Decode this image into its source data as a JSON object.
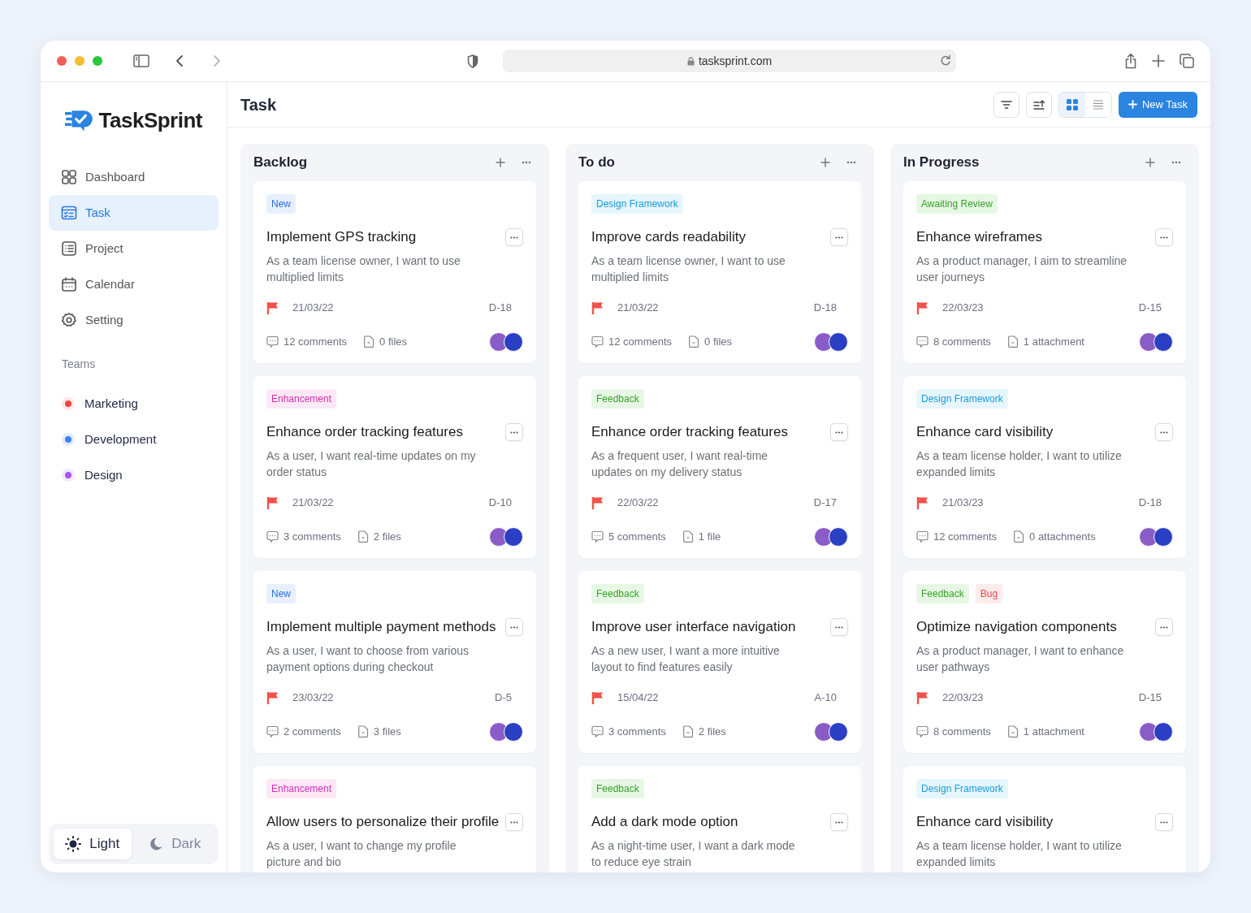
{
  "browser": {
    "url": "tasksprint.com"
  },
  "sidebar": {
    "logo": "TaskSprint",
    "items": [
      {
        "label": "Dashboard",
        "kind": "grid",
        "selected": false
      },
      {
        "label": "Task",
        "kind": "task",
        "selected": true
      },
      {
        "label": "Project",
        "kind": "list",
        "selected": false
      },
      {
        "label": "Calendar",
        "kind": "calendar",
        "selected": false
      },
      {
        "label": "Setting",
        "kind": "gear",
        "selected": false
      }
    ],
    "teams_heading": "Teams",
    "teams": [
      {
        "label": "Marketing",
        "color": "#ef4444"
      },
      {
        "label": "Development",
        "color": "#3b82f6"
      },
      {
        "label": "Design",
        "color": "#a855f7"
      }
    ],
    "theme": [
      {
        "label": "Light",
        "kind": "sun",
        "selected": true
      },
      {
        "label": "Dark",
        "kind": "moon",
        "selected": false
      }
    ]
  },
  "header": {
    "title": "Task",
    "view": [
      {
        "kind": "grid",
        "selected": true
      },
      {
        "kind": "list",
        "selected": false
      }
    ],
    "new_button": "New Task"
  },
  "columns": [
    {
      "title": "Backlog",
      "cards": [
        {
          "tags": [
            {
              "label": "New",
              "kind": "blue"
            }
          ],
          "title": "Implement GPS tracking",
          "desc": "As a team license owner, I want to use multiplied limits",
          "date": "21/03/22",
          "code": "D-18",
          "comments": "12 comments",
          "files": "0 files"
        },
        {
          "tags": [
            {
              "label": "Enhancement",
              "kind": "pink"
            }
          ],
          "title": "Enhance order tracking features",
          "desc": "As a user, I want real-time updates on my order status",
          "date": "21/03/22",
          "code": "D-10",
          "comments": "3 comments",
          "files": "2 files"
        },
        {
          "tags": [
            {
              "label": "New",
              "kind": "blue"
            }
          ],
          "title": "Implement multiple payment methods",
          "desc": "As a user, I want to choose from various payment options during checkout",
          "date": "23/03/22",
          "code": "D-5",
          "comments": "2 comments",
          "files": "3 files"
        },
        {
          "tags": [
            {
              "label": "Enhancement",
              "kind": "pink"
            }
          ],
          "title": "Allow users to personalize their profile",
          "desc": "As a user, I want to change my profile picture and bio"
        }
      ]
    },
    {
      "title": "To do",
      "cards": [
        {
          "tags": [
            {
              "label": "Design Framework",
              "kind": "cyan"
            }
          ],
          "title": "Improve cards readability",
          "desc": "As a team license owner, I want to use multiplied limits",
          "date": "21/03/22",
          "code": "D-18",
          "comments": "12 comments",
          "files": "0 files"
        },
        {
          "tags": [
            {
              "label": "Feedback",
              "kind": "green"
            }
          ],
          "title": "Enhance order tracking features",
          "desc": "As a frequent user, I want real-time updates on my delivery status",
          "date": "22/03/22",
          "code": "D-17",
          "comments": "5 comments",
          "files": "1 file"
        },
        {
          "tags": [
            {
              "label": "Feedback",
              "kind": "green"
            }
          ],
          "title": "Improve user interface navigation",
          "desc": "As a new user, I want a more intuitive layout to find features easily",
          "date": "15/04/22",
          "code": "A-10",
          "comments": "3 comments",
          "files": "2 files"
        },
        {
          "tags": [
            {
              "label": "Feedback",
              "kind": "green"
            }
          ],
          "title": "Add a dark mode option",
          "desc": "As a night-time user, I want a dark mode to reduce eye strain"
        }
      ]
    },
    {
      "title": "In Progress",
      "cards": [
        {
          "tags": [
            {
              "label": "Awaiting Review",
              "kind": "green"
            }
          ],
          "title": "Enhance wireframes",
          "desc": "As a product manager, I aim to streamline user journeys",
          "date": "22/03/23",
          "code": "D-15",
          "comments": "8 comments",
          "files": "1 attachment"
        },
        {
          "tags": [
            {
              "label": "Design Framework",
              "kind": "cyan"
            }
          ],
          "title": "Enhance card visibility",
          "desc": "As a team license holder, I want to utilize expanded limits",
          "date": "21/03/23",
          "code": "D-18",
          "comments": "12 comments",
          "files": "0 attachments"
        },
        {
          "tags": [
            {
              "label": "Feedback",
              "kind": "green"
            },
            {
              "label": "Bug",
              "kind": "red"
            }
          ],
          "title": "Optimize navigation components",
          "desc": "As a product manager, I want to enhance user pathways",
          "date": "22/03/23",
          "code": "D-15",
          "comments": "8 comments",
          "files": "1 attachment"
        },
        {
          "tags": [
            {
              "label": "Design Framework",
              "kind": "cyan"
            }
          ],
          "title": "Enhance card visibility",
          "desc": "As a team license holder, I want to utilize expanded limits"
        }
      ]
    }
  ]
}
